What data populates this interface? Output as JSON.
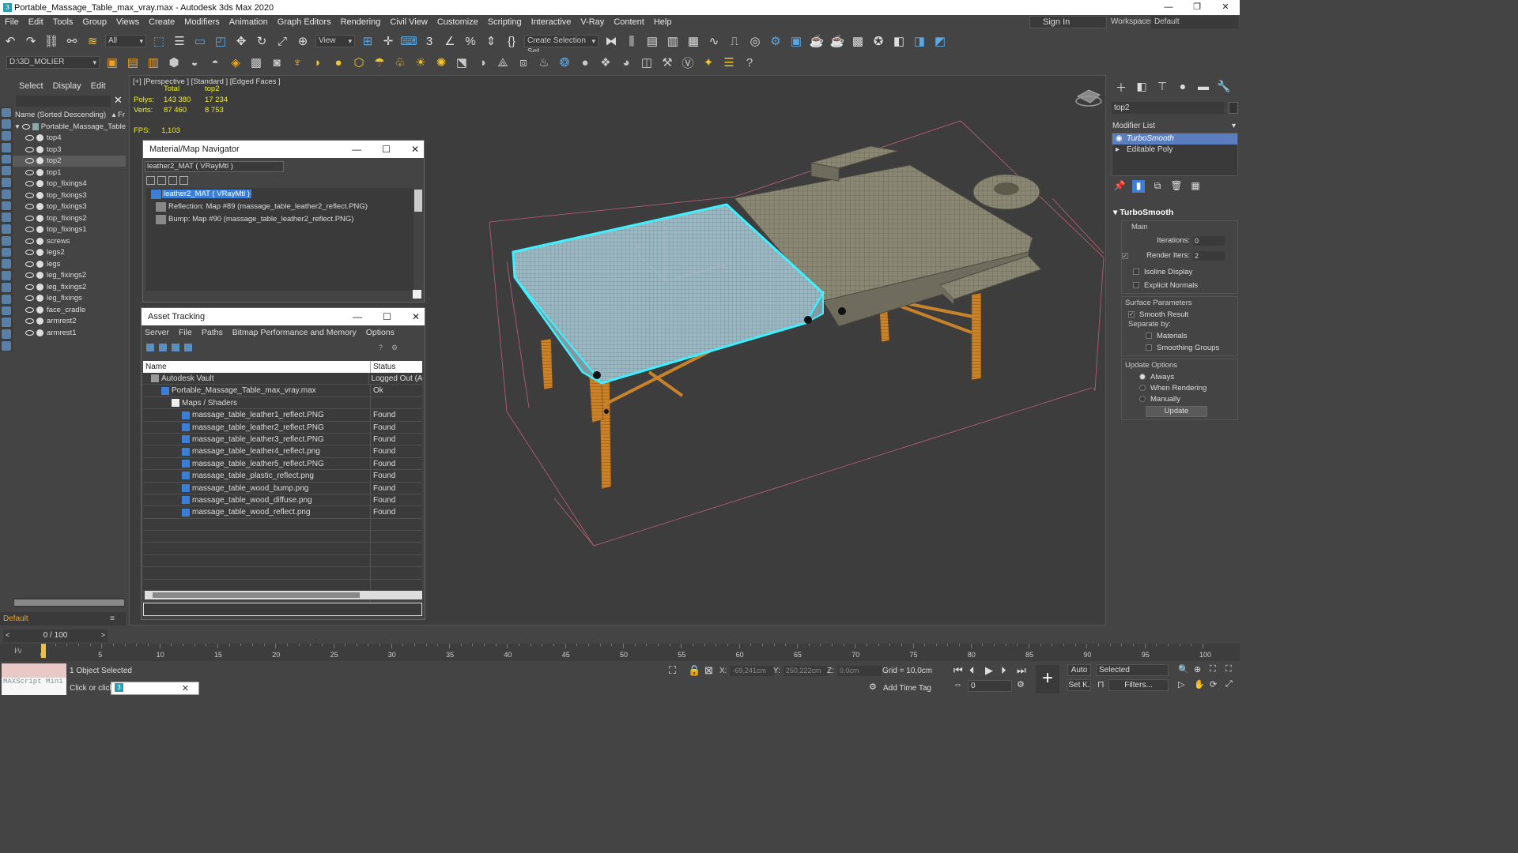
{
  "app": {
    "title": "Portable_Massage_Table_max_vray.max - Autodesk 3ds Max 2020",
    "icon_glyph": "3"
  },
  "menu": [
    "File",
    "Edit",
    "Tools",
    "Group",
    "Views",
    "Create",
    "Modifiers",
    "Animation",
    "Graph Editors",
    "Rendering",
    "Civil View",
    "Customize",
    "Scripting",
    "Interactive",
    "V-Ray",
    "Content",
    "Help"
  ],
  "header": {
    "sign_in": "Sign In",
    "workspaces_label": "Workspaces:",
    "workspace_value": "Default"
  },
  "toolbar": {
    "filter_value": "All",
    "view_value": "View",
    "selection_set": "Create Selection Set",
    "project_path": "D:\\3D_MOLIER"
  },
  "scene_explorer": {
    "tabs": [
      "Select",
      "Display",
      "Edit"
    ],
    "column_header": "Name (Sorted Descending)",
    "column_header_extra": "▴ Fr",
    "root": "Portable_Massage_Table",
    "items": [
      "top4",
      "top3",
      "top2",
      "top1",
      "top_fixings4",
      "top_fixings3",
      "top_fixings3",
      "top_fixings2",
      "top_fixings1",
      "screws",
      "legs2",
      "legs",
      "leg_fixings2",
      "leg_fixings2",
      "leg_fixings",
      "face_cradle",
      "armrest2",
      "armrest1"
    ],
    "selected_index": 2,
    "layer": "Default"
  },
  "viewport": {
    "label": "[+] [Perspective ] [Standard ] [Edged Faces ]",
    "stats": {
      "col_total": "Total",
      "col_sel": "top2",
      "polys_label": "Polys:",
      "polys_total": "143 380",
      "polys_sel": "17 234",
      "verts_label": "Verts:",
      "verts_total": "87 460",
      "verts_sel": "8 753"
    },
    "fps_label": "FPS:",
    "fps_value": "1,103"
  },
  "material_navigator": {
    "title": "Material/Map Navigator",
    "field": "leather2_MAT  ( VRayMtl )",
    "rows": [
      "leather2_MAT  ( VRayMtl )",
      "Reflection: Map #89 (massage_table_leather2_reflect.PNG)",
      "Bump: Map #90 (massage_table_leather2_reflect.PNG)"
    ]
  },
  "asset_tracking": {
    "title": "Asset Tracking",
    "menu": [
      "Server",
      "File",
      "Paths",
      "Bitmap Performance and Memory",
      "Options"
    ],
    "col_name": "Name",
    "col_status": "Status",
    "rows": [
      {
        "name": "Autodesk Vault",
        "status": "Logged Out (A",
        "indent": 0
      },
      {
        "name": "Portable_Massage_Table_max_vray.max",
        "status": "Ok",
        "indent": 1
      },
      {
        "name": "Maps / Shaders",
        "status": "",
        "indent": 2
      },
      {
        "name": "massage_table_leather1_reflect.PNG",
        "status": "Found",
        "indent": 3
      },
      {
        "name": "massage_table_leather2_reflect.PNG",
        "status": "Found",
        "indent": 3
      },
      {
        "name": "massage_table_leather3_reflect.PNG",
        "status": "Found",
        "indent": 3
      },
      {
        "name": "massage_table_leather4_reflect.png",
        "status": "Found",
        "indent": 3
      },
      {
        "name": "massage_table_leather5_reflect.PNG",
        "status": "Found",
        "indent": 3
      },
      {
        "name": "massage_table_plastic_reflect.png",
        "status": "Found",
        "indent": 3
      },
      {
        "name": "massage_table_wood_bump.png",
        "status": "Found",
        "indent": 3
      },
      {
        "name": "massage_table_wood_diffuse.png",
        "status": "Found",
        "indent": 3
      },
      {
        "name": "massage_table_wood_reflect.png",
        "status": "Found",
        "indent": 3
      }
    ],
    "empty_rows": 7
  },
  "command_panel": {
    "object_name": "top2",
    "modifier_list": "Modifier List",
    "stack": [
      "TurboSmooth",
      "Editable Poly"
    ],
    "turbosmooth": {
      "title": "TurboSmooth",
      "main": "Main",
      "iterations_label": "Iterations:",
      "iterations": "0",
      "render_iters_label": "Render Iters:",
      "render_iters": "2",
      "isoline": "Isoline Display",
      "explicit_normals": "Explicit Normals",
      "surface_params": "Surface Parameters",
      "smooth_result": "Smooth Result",
      "separate_by": "Separate by:",
      "materials": "Materials",
      "smoothing_groups": "Smoothing Groups",
      "update_options": "Update Options",
      "always": "Always",
      "when_rendering": "When Rendering",
      "manually": "Manually",
      "update_btn": "Update"
    }
  },
  "timeline": {
    "slider": "0 / 100",
    "ticks": [
      "0",
      "5",
      "10",
      "15",
      "20",
      "25",
      "30",
      "35",
      "40",
      "45",
      "50",
      "55",
      "60",
      "65",
      "70",
      "75",
      "80",
      "85",
      "90",
      "95",
      "100"
    ]
  },
  "status_bar": {
    "maxscript": "MAXScript Mini",
    "selection": "1 Object Selected",
    "prompt": "Click or click",
    "x_label": "X:",
    "x": "-69,241cm",
    "y_label": "Y:",
    "y": "250,222cm",
    "z_label": "Z:",
    "z": "0,0cm",
    "grid": "Grid = 10,0cm",
    "add_time_tag": "Add Time Tag",
    "auto": "Auto",
    "set_k": "Set K.",
    "selected": "Selected",
    "filters": "Filters...",
    "frame": "0"
  },
  "colors": {
    "selection": "#3ff0ff",
    "accent": "#5a7ec0",
    "wood": "#c8822c"
  }
}
